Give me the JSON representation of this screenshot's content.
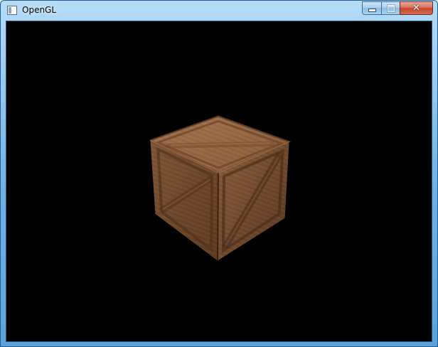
{
  "window": {
    "title": "OpenGL",
    "icon": "app-window-icon"
  },
  "caption": {
    "minimize_icon": "minimize-icon",
    "maximize_icon": "maximize-icon",
    "close_label": "✕",
    "close_color": "#c7462a"
  },
  "viewport": {
    "background": "#000000",
    "object": "wooden-crate",
    "crate_colors": {
      "light": "#9a6a45",
      "mid": "#7a4f30",
      "dark": "#4e2f1a"
    }
  }
}
